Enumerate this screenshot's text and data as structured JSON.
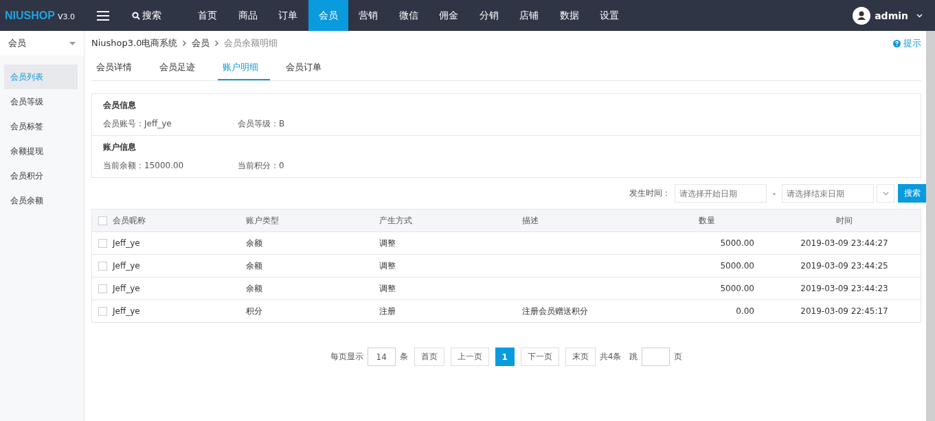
{
  "header": {
    "logo": {
      "brand": "NIUSHOP",
      "version": "V3.0"
    },
    "search": "搜索",
    "nav": [
      {
        "label": "首页",
        "selected": false
      },
      {
        "label": "商品",
        "selected": false
      },
      {
        "label": "订单",
        "selected": false
      },
      {
        "label": "会员",
        "selected": true
      },
      {
        "label": "营销",
        "selected": false
      },
      {
        "label": "微信",
        "selected": false
      },
      {
        "label": "佣金",
        "selected": false
      },
      {
        "label": "分销",
        "selected": false
      },
      {
        "label": "店铺",
        "selected": false
      },
      {
        "label": "数据",
        "selected": false
      },
      {
        "label": "设置",
        "selected": false
      }
    ],
    "user": "admin"
  },
  "sidebar": {
    "title": "会员",
    "items": [
      {
        "label": "会员列表",
        "selected": true
      },
      {
        "label": "会员等级",
        "selected": false
      },
      {
        "label": "会员标签",
        "selected": false
      },
      {
        "label": "余额提现",
        "selected": false
      },
      {
        "label": "会员积分",
        "selected": false
      },
      {
        "label": "会员余额",
        "selected": false
      }
    ]
  },
  "breadcrumb": [
    "Niushop3.0电商系统",
    "会员",
    "会员余额明细"
  ],
  "hint": "提示",
  "tabs": [
    {
      "label": "会员详情",
      "selected": false
    },
    {
      "label": "会员足迹",
      "selected": false
    },
    {
      "label": "账户明细",
      "selected": true
    },
    {
      "label": "会员订单",
      "selected": false
    }
  ],
  "info_sections": [
    {
      "title": "会员信息",
      "fields": [
        "会员账号：Jeff_ye",
        "会员等级：B"
      ]
    },
    {
      "title": "账户信息",
      "fields": [
        "当前余额：15000.00",
        "当前积分：0"
      ]
    }
  ],
  "filter": {
    "label": "发生时间：",
    "start_placeholder": "请选择开始日期",
    "separator": "-",
    "end_placeholder": "请选择结束日期",
    "button": "搜索"
  },
  "table": {
    "all_checked": false,
    "columns": [
      "会员昵称",
      "账户类型",
      "产生方式",
      "描述",
      "数量",
      "时间"
    ],
    "rows": [
      {
        "checked": false,
        "cells": [
          "Jeff_ye",
          "余额",
          "调整",
          "",
          "5000.00",
          "2019-03-09 23:44:27"
        ]
      },
      {
        "checked": false,
        "cells": [
          "Jeff_ye",
          "余额",
          "调整",
          "",
          "5000.00",
          "2019-03-09 23:44:25"
        ]
      },
      {
        "checked": false,
        "cells": [
          "Jeff_ye",
          "余额",
          "调整",
          "",
          "5000.00",
          "2019-03-09 23:44:23"
        ]
      },
      {
        "checked": false,
        "cells": [
          "Jeff_ye",
          "积分",
          "注册",
          "注册会员赠送积分",
          "0.00",
          "2019-03-09 22:45:17"
        ]
      }
    ]
  },
  "pagination": {
    "per_page_label": "每页显示",
    "per_page": "14",
    "per_page_unit": "条",
    "first": "首页",
    "prev": "上一页",
    "pages": [
      {
        "label": "1",
        "selected": true
      }
    ],
    "next": "下一页",
    "last": "末页",
    "total": "共4条",
    "jump_label": "跳",
    "jump_unit": "页"
  }
}
